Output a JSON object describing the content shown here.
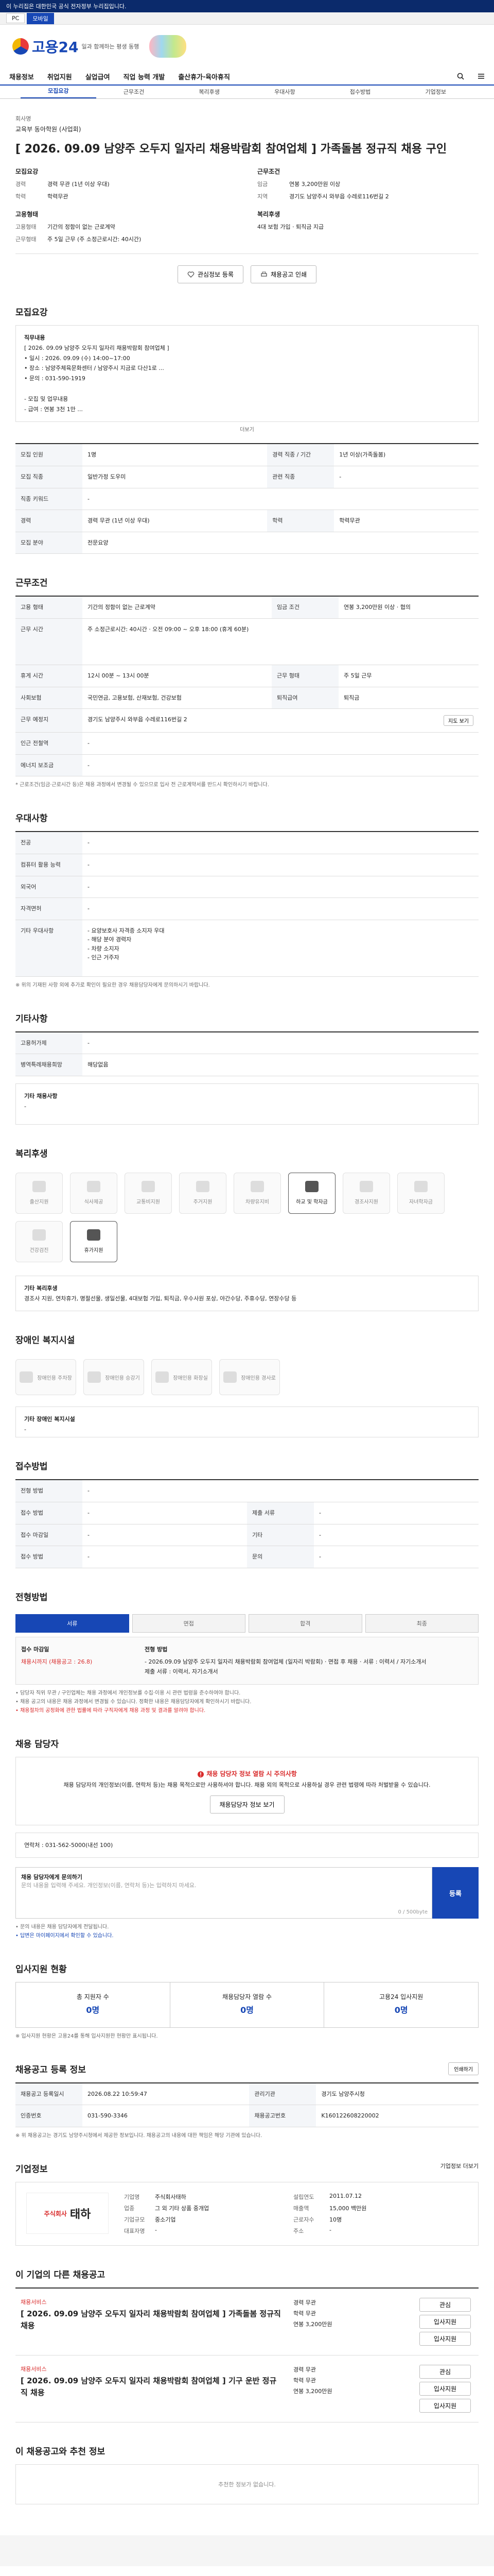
{
  "notice_bar": "이 누리집은 대한민국 공식 전자정부 누리집입니다.",
  "env_tabs": [
    "PC",
    "모바일"
  ],
  "logo": {
    "text": "고용24",
    "sub": "일과 함께하는 평생 동행"
  },
  "gnb": [
    "채용정보",
    "취업지원",
    "실업급여",
    "직업 능력 개발",
    "출산휴가·육아휴직"
  ],
  "tabs": [
    "모집요강",
    "근무조건",
    "복리후생",
    "우대사항",
    "접수방법",
    "기업정보"
  ],
  "summary": {
    "company_label": "회사명",
    "company": "교육부 동아학원 (사업회)",
    "title": "[ 2026. 09.09 남양주 오두지 일자리 채용박람회 참여업체 ] 가족돌봄 정규직 채용 구인",
    "left_head": "모집요강",
    "left": [
      {
        "k": "경력",
        "v": "경력 무관 (1년 이상 우대)"
      },
      {
        "k": "학력",
        "v": "학력무관"
      }
    ],
    "right_head": "근무조건",
    "right": [
      {
        "k": "임금",
        "v": "연봉 3,200만원 이상"
      },
      {
        "k": "지역",
        "v": "경기도 남양주시 와부읍 수레로116번길 2"
      }
    ],
    "left2_head": "고용형태",
    "left2": [
      {
        "k": "고용형태",
        "v": "기간의 정함이 없는 근로계약"
      },
      {
        "k": "근무형태",
        "v": "주 5일 근무 (주 소정근로시간: 40시간)"
      }
    ],
    "right2_head": "복리후생",
    "right2": [
      {
        "k": "",
        "v": "4대 보험 가입 · 퇴직금 지급"
      }
    ],
    "btn_interest": "관심정보 등록",
    "btn_print": "채용공고 인쇄"
  },
  "recruit": {
    "heading": "모집요강",
    "job_head": "직무내용",
    "job_text": [
      "[ 2026. 09.09 남양주 오두지 일자리 채용박람회 참여업체 ]",
      "• 일시 : 2026. 09.09 (수) 14:00~17:00",
      "• 장소 : 남양주체육문화센터 / 남양주시 지금로 다산1로 ...",
      "• 문의 : 031-590-1919",
      "",
      "- 모집 및 업무내용",
      "- 급여 : 연봉 3천 1만 ..."
    ],
    "more": "더보기",
    "rows": [
      {
        "k1": "모집 인원",
        "v1": "1명",
        "k2": "경력 직종 / 기간",
        "v2": "1년 이상(가족돌봄)"
      },
      {
        "k1": "모집 직종",
        "v1": "일반가정 도우미",
        "k2": "관련 직종",
        "v2": "-"
      },
      {
        "k1": "직종 키워드",
        "v1": "-",
        "k2": "",
        "v2": ""
      },
      {
        "k1": "경력",
        "v1": "경력 무관 (1년 이상 우대)",
        "k2": "학력",
        "v2": "학력무관"
      },
      {
        "k1": "모집 분야",
        "v1": "전문요양",
        "k2": "",
        "v2": ""
      }
    ]
  },
  "work": {
    "heading": "근무조건",
    "rows": [
      {
        "k1": "고용 형태",
        "v1": "기간의 정함이 없는 근로계약",
        "k2": "임금 조건",
        "v2": "연봉 3,200만원 이상 · 협의"
      },
      {
        "k1": "근무 시간",
        "v1": "주 소정근로시간: 40시간 · 오전 09:00 ~ 오후 18:00 (휴게 60분)",
        "k2": "",
        "v2": ""
      },
      {
        "k1": "휴게 시간",
        "v1": "12시 00분 ~ 13시 00분",
        "k2": "근무 형태",
        "v2": "주 5일 근무"
      },
      {
        "k1": "사회보험",
        "v1": "국민연금, 고용보험, 산재보험, 건강보험",
        "k2": "퇴직급여",
        "v2": "퇴직금"
      },
      {
        "k1": "근무 예정지",
        "v1": "경기도 남양주시 와부읍 수레로116번길 2",
        "k2": "",
        "v2": ""
      },
      {
        "k1": "인근 전철역",
        "v1": "-",
        "k2": "",
        "v2": ""
      },
      {
        "k1": "에너지 보조금",
        "v1": "-",
        "k2": "",
        "v2": ""
      }
    ],
    "map_btn": "지도 보기",
    "note": "* 근로조건(임금·근로시간 등)은 채용 과정에서 변경될 수 있으므로 입사 전 근로계약서를 반드시 확인하시기 바랍니다."
  },
  "pref": {
    "heading": "우대사항",
    "rows": [
      {
        "k": "전공",
        "v": "-"
      },
      {
        "k": "컴퓨터 활용 능력",
        "v": "-"
      },
      {
        "k": "외국어",
        "v": "-"
      },
      {
        "k": "자격면허",
        "v": "-"
      },
      {
        "k": "기타 우대사항",
        "v": "- 요양보호사 자격증 소지자 우대\n- 해당 분야 경력자\n- 차량 소지자\n- 인근 거주자"
      }
    ],
    "note": "※ 위의 기재된 사항 외에 추가로 확인이 필요한 경우 채용담당자에게 문의하시기 바랍니다."
  },
  "etc": {
    "heading": "기타사항",
    "rows": [
      {
        "k": "고용허가제",
        "v": "-"
      },
      {
        "k": "병역특례채용희망",
        "v": "해당없음"
      }
    ],
    "free_head": "기타 채용사항",
    "free_text": "-"
  },
  "welfare": {
    "heading": "복리후생",
    "items": [
      {
        "name": "출산지원",
        "on": false
      },
      {
        "name": "식사제공",
        "on": false
      },
      {
        "name": "교통비지원",
        "on": false
      },
      {
        "name": "주거지원",
        "on": false
      },
      {
        "name": "차량유지비",
        "on": false
      },
      {
        "name": "하교 및 학자금",
        "on": true
      },
      {
        "name": "경조사지원",
        "on": false
      },
      {
        "name": "자녀학자금",
        "on": false
      },
      {
        "name": "건강검진",
        "on": false
      },
      {
        "name": "휴가지원",
        "on": true
      }
    ],
    "etc_head": "기타 복리후생",
    "etc_text": "경조사 지원, 연차휴가, 명절선물, 생일선물, 4대보험 가입, 퇴직금, 우수사원 포상, 야간수당, 주휴수당, 연장수당 등"
  },
  "disability": {
    "heading": "장애인 복지시설",
    "items": [
      "장애인용 주차장",
      "장애인용 승강기",
      "장애인용 화장실",
      "장애인용 경사로"
    ],
    "etc_head": "기타 장애인 복지시설",
    "etc_text": "-"
  },
  "apply": {
    "heading": "접수방법",
    "rows": [
      {
        "k1": "전형 방법",
        "v1": "-",
        "k2": "",
        "v2": ""
      },
      {
        "k1": "접수 방법",
        "v1": "-",
        "k2": "제출 서류",
        "v2": "-"
      },
      {
        "k1": "접수 마감일",
        "v1": "-",
        "k2": "기타",
        "v2": "-"
      },
      {
        "k1": "접수 방법",
        "v1": "-",
        "k2": "문의",
        "v2": "-"
      }
    ]
  },
  "progress": {
    "heading": "전형방법",
    "stages": [
      "서류",
      "면접",
      "합격",
      "최종"
    ],
    "stage_on": 0,
    "l1": "접수 마감일",
    "v1": "채용시까지 (채용공고 : 26.8)",
    "l2": "전형 방법",
    "v2": "- 2026.09.09 남양주 오두지 일자리 채용박람회 참여업체 (일자리 박람회) · 면접 후 채용 · 서류 : 이력서 / 자기소개서",
    "v3": "제출 서류 : 이력서, 자기소개서",
    "notes": [
      "• 담당자 직위 무관 / 구인업체는 채용 과정에서 개인정보를 수집·이용 시 관련 법령을 준수하여야 합니다.",
      "• 채용 공고의 내용은 채용 과정에서 변경될 수 있습니다. 정확한 내용은 채용담당자에게 확인하시기 바랍니다.",
      "• 채용절차의 공정화에 관한 법률에 따라 구직자에게 채용 과정 및 결과를 알려야 합니다."
    ]
  },
  "contact": {
    "heading": "채용 담당자",
    "warn_title": "채용 담당자 정보 열람 시 주의사항",
    "warn_text": "채용 담당자의 개인정보(이름, 연락처 등)는 채용 목적으로만 사용하셔야 합니다. 채용 외의 목적으로 사용하실 경우 관련 법령에 따라 처벌받을 수 있습니다.",
    "view_btn": "채용담당자 정보 보기",
    "phone": "연락처 : 031-562-5000(내선 100)",
    "inq_head": "채용 담당자에게 문의하기",
    "inq_placeholder": "문의 내용을 입력해 주세요. 개인정보(이름, 연락처 등)는 입력하지 마세요.",
    "inq_count": "0 / 500byte",
    "inq_btn": "등록",
    "notes": [
      "• 문의 내용은 채용 담당자에게 전달됩니다.",
      "• 답변은 마이페이지에서 확인할 수 있습니다."
    ]
  },
  "applicants": {
    "heading": "입사지원 현황",
    "items": [
      {
        "label": "총 지원자 수",
        "value": "0명"
      },
      {
        "label": "채용담당자 열람 수",
        "value": "0명"
      },
      {
        "label": "고용24 입사지원",
        "value": "0명"
      }
    ],
    "note": "※ 입사지원 현황은 고용24를 통해 입사지원한 현황만 표시됩니다."
  },
  "regist": {
    "heading": "채용공고 등록 정보",
    "rows": [
      {
        "k1": "채용공고 등록일시",
        "v1": "2026.08.22 10:59:47",
        "k2": "관리기관",
        "v2": "경기도 남양주시청"
      },
      {
        "k1": "인증번호",
        "v1": "031-590-3346",
        "k2": "채용공고번호",
        "v2": "K160122608220002"
      }
    ],
    "btn": "인쇄하기",
    "note": "※ 위 채용공고는 경기도 남양주시청에서 제공한 정보입니다. 채용공고의 내용에 대한 책임은 해당 기관에 있습니다."
  },
  "company": {
    "heading": "기업정보",
    "more": "기업정보 더보기",
    "logo_mark": "주식회사",
    "logo_text": "태하",
    "kv": [
      {
        "k": "기업명",
        "v": "주식회사태하"
      },
      {
        "k": "설립연도",
        "v": "2011.07.12"
      },
      {
        "k": "업종",
        "v": "그 외 기타 상품 중개업"
      },
      {
        "k": "매출액",
        "v": "15,000 백만원"
      },
      {
        "k": "기업규모",
        "v": "중소기업"
      },
      {
        "k": "근로자수",
        "v": "10명"
      },
      {
        "k": "대표자명",
        "v": "-"
      },
      {
        "k": "주소",
        "v": "-"
      }
    ]
  },
  "related": {
    "heading": "이 기업의 다른 채용공고",
    "items": [
      {
        "company": "채용서비스",
        "title": "[ 2026. 09.09 남양주 오두지 일자리 채용박람회 참여업체 ] 가족돌봄 정규직 채용",
        "m1": "경력 무관",
        "m2": "학력 무관",
        "m3": "연봉 3,200만원",
        "btn1": "관심",
        "btn2": "입사지원",
        "btn3": "입사지원"
      },
      {
        "company": "채용서비스",
        "title": "[ 2026. 09.09 남양주 오두지 일자리 채용박람회 참여업체 ] 기구 운반 정규직 채용",
        "m1": "경력 무관",
        "m2": "학력 무관",
        "m3": "연봉 3,200만원",
        "btn1": "관심",
        "btn2": "입사지원",
        "btn3": "입사지원"
      }
    ]
  },
  "recommend": {
    "heading": "이 채용공고와 추천 정보",
    "empty": "추천한 정보가 없습니다."
  }
}
